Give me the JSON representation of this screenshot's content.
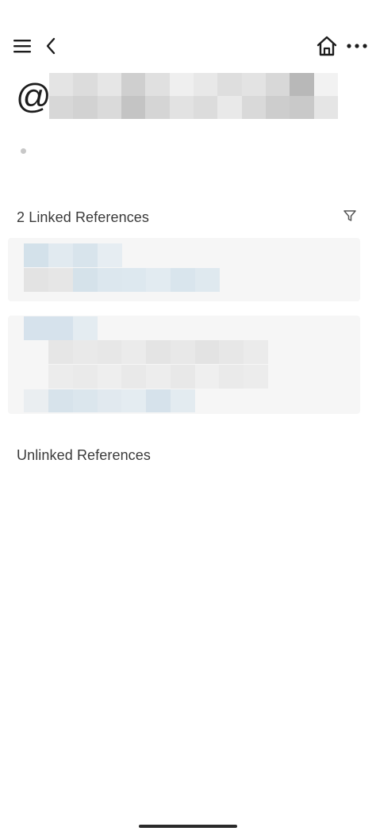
{
  "header": {
    "menu_icon": "hamburger-menu-icon",
    "back_icon": "chevron-left-icon",
    "home_icon": "home-icon",
    "more_icon": "more-horizontal-icon"
  },
  "page": {
    "title_prefix": "@",
    "title_redacted": true
  },
  "linked_references": {
    "heading": "2 Linked References",
    "filter_icon": "filter-icon",
    "items": [
      {
        "redacted": true
      },
      {
        "redacted": true
      }
    ]
  },
  "unlinked_references": {
    "heading": "Unlinked References"
  },
  "colors": {
    "text": "#333333",
    "card_bg": "#f6f6f6",
    "pixel_grey": "#d6d6d6",
    "pixel_blue": "#dbe6ee"
  }
}
